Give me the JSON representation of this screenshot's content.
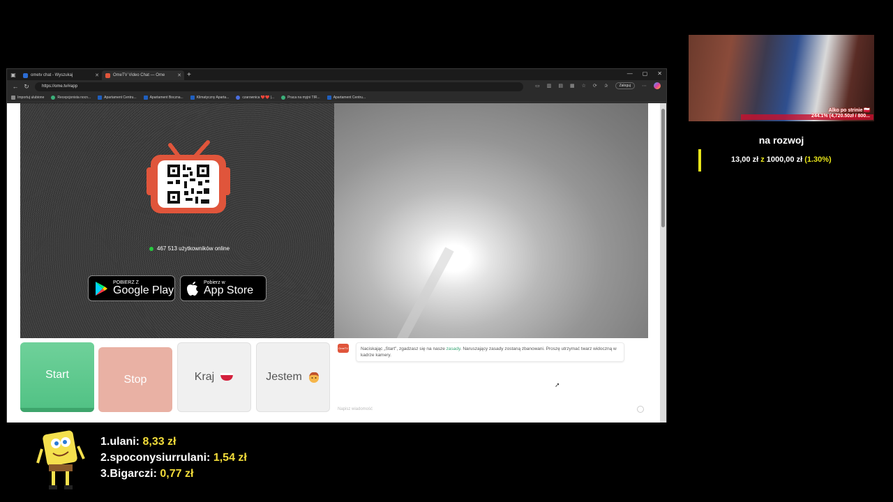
{
  "browser": {
    "tabs": [
      {
        "title": "ometv chat - Wyszukaj",
        "active": false
      },
      {
        "title": "OmeTV Video Chat — Ome",
        "active": true
      }
    ],
    "url": "https://ome.tv/#app",
    "login_label": "Zaloguj",
    "bookmarks": [
      "Importuj ulubione",
      "Recepcjonista nocn...",
      "Apartament Centru...",
      "Apartament Boczna...",
      "Klimatyczny Aparta...",
      "czarownica ❤️❤️ |...",
      "Praca na myjni TIR...",
      "Apartament Centru..."
    ]
  },
  "app": {
    "online_count": "467 513 użytkowników online",
    "google_play": {
      "small": "POBIERZ Z",
      "big": "Google Play"
    },
    "app_store": {
      "small": "Pobierz w",
      "big": "App Store"
    },
    "buttons": {
      "start": "Start",
      "stop": "Stop",
      "country": "Kraj",
      "gender": "Jestem"
    },
    "chat": {
      "avatar_text": "OmeTV",
      "message_before": "Naciskając „Start\", zgadzasz się na nasze ",
      "message_link": "zasady",
      "message_after": ". Naruszający zasady zostaną zbanowani. Proszę utrzymać twarz widoczną w kadrze kamery.",
      "input_placeholder": "Napisz wiadomość"
    }
  },
  "overlay": {
    "cam_text_line1": "Alko po strinie 🇵🇱",
    "cam_text_line2": "244.1% (4,720.50zł / 800...",
    "goal": {
      "title": "na rozwoj",
      "current": "13,00 zł",
      "separator": "z",
      "target": "1000,00 zł",
      "percent": "(1.30%)",
      "progress_fraction": 0.013
    },
    "donors": [
      {
        "rank": "1.",
        "name": "ulani:",
        "amount": "8,33 zł"
      },
      {
        "rank": "2.",
        "name": "spoconysiurrulani:",
        "amount": "1,54 zł"
      },
      {
        "rank": "3.",
        "name": "Bigarczi:",
        "amount": "0,77 zł"
      }
    ],
    "accent": "#e8e51a"
  }
}
